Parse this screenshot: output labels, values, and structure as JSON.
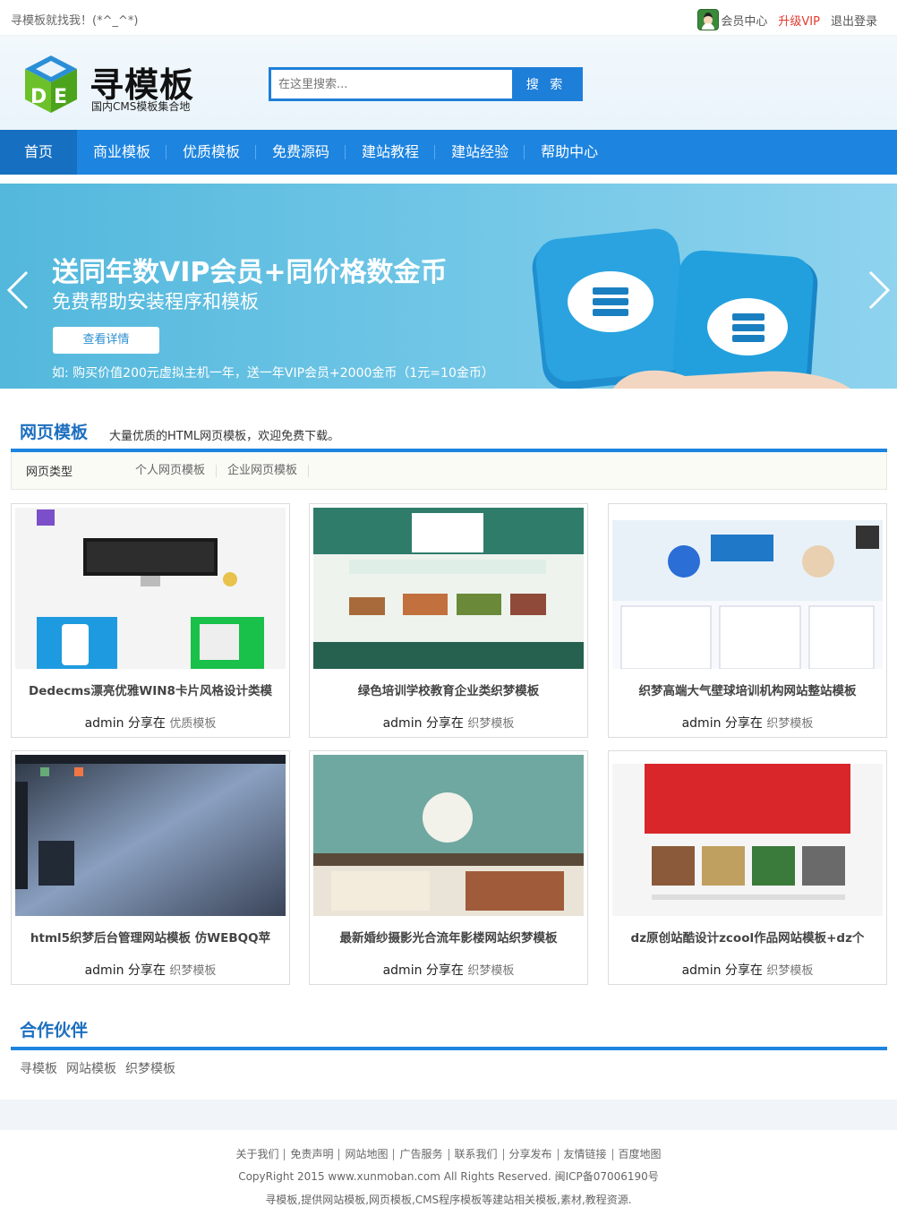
{
  "topbar": {
    "greeting": "寻模板就找我！(*^_^*)",
    "member_center": "会员中心",
    "upgrade_vip": "升级VIP",
    "logout": "退出登录"
  },
  "header": {
    "logo_name": "寻模板",
    "logo_slogan": "国内CMS模板集合地",
    "search_placeholder": "在这里搜索...",
    "search_button": "搜 索"
  },
  "nav": {
    "items": [
      "首页",
      "商业模板",
      "优质模板",
      "免费源码",
      "建站教程",
      "建站经验",
      "帮助中心"
    ]
  },
  "banner": {
    "headline": "送同年数VIP会员+同价格数金币",
    "sub": "免费帮助安装程序和模板",
    "button": "查看详情",
    "note": "如: 购买价值200元虚拟主机一年，送一年VIP会员+2000金币（1元=10金币）"
  },
  "templates": {
    "title": "网页模板",
    "desc": "大量优质的HTML网页模板，欢迎免费下载。",
    "filter_label": "网页类型",
    "filter_options": [
      "个人网页模板",
      "企业网页模板"
    ],
    "cards": [
      {
        "title": "Dedecms漂亮优雅WIN8卡片风格设计类模",
        "author": "admin 分享在",
        "tag": "优质模板"
      },
      {
        "title": "绿色培训学校教育企业类织梦模板",
        "author": "admin 分享在",
        "tag": "织梦模板"
      },
      {
        "title": "织梦高端大气壁球培训机构网站整站模板",
        "author": "admin 分享在",
        "tag": "织梦模板"
      },
      {
        "title": "html5织梦后台管理网站模板 仿WEBQQ苹",
        "author": "admin 分享在",
        "tag": "织梦模板"
      },
      {
        "title": "最新婚纱摄影光合流年影楼网站织梦模板",
        "author": "admin 分享在",
        "tag": "织梦模板"
      },
      {
        "title": "dz原创站酷设计zcool作品网站模板+dz个",
        "author": "admin 分享在",
        "tag": "织梦模板"
      }
    ]
  },
  "partners": {
    "title": "合作伙伴",
    "links": [
      "寻模板",
      "网站模板",
      "织梦模板"
    ]
  },
  "footer": {
    "links": [
      "关于我们",
      "免责声明",
      "网站地图",
      "广告服务",
      "联系我们",
      "分享发布",
      "友情链接",
      "百度地图"
    ],
    "copyright": "CopyRight 2015 www.xunmoban.com All Rights Reserved. 闽ICP备07006190号",
    "description": "寻模板,提供网站模板,网页模板,CMS程序模板等建站相关模板,素材,教程资源."
  },
  "colors": {
    "primary": "#1d84e0",
    "vip": "#e23b2e"
  }
}
